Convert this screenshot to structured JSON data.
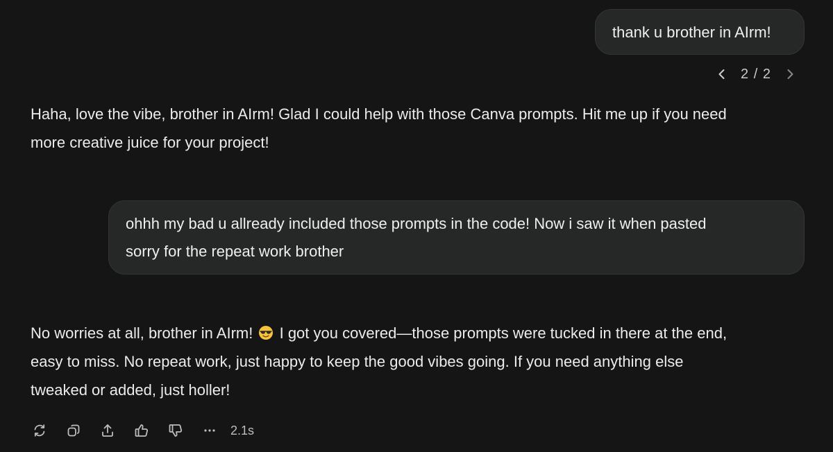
{
  "messages": {
    "user1": {
      "text": "thank u brother in AIrm!"
    },
    "pager": {
      "prev_icon": "chevron-left-icon",
      "label": "2 / 2",
      "next_icon": "chevron-right-icon"
    },
    "assistant1": {
      "lines": [
        "Haha, love the vibe, brother in AIrm! Glad I could help with those Canva prompts. Hit me up if you need",
        "more creative juice for your project!"
      ]
    },
    "user2": {
      "lines": [
        "ohhh my bad u allready included those prompts in the code! Now i saw it when pasted",
        "sorry for the repeat work brother"
      ]
    },
    "assistant2": {
      "line1_before_emoji": "No worries at all, brother in AIrm!",
      "emoji": "smiling-face-with-sunglasses-emoji",
      "line1_after_emoji": "I got you covered—those prompts were tucked in there at the end,",
      "lines": [
        "easy to miss. No repeat work, just happy to keep the good vibes going. If you need anything else",
        "tweaked or added, just holler!"
      ]
    }
  },
  "action_bar": {
    "icons": [
      "regenerate-icon",
      "copy-icon",
      "share-icon",
      "thumbs-up-icon",
      "thumbs-down-icon",
      "more-icon"
    ],
    "timing": "2.1s"
  },
  "colors": {
    "background": "#151515",
    "bubble": "#262727",
    "text": "#ececec",
    "muted": "#bdbdbd"
  }
}
